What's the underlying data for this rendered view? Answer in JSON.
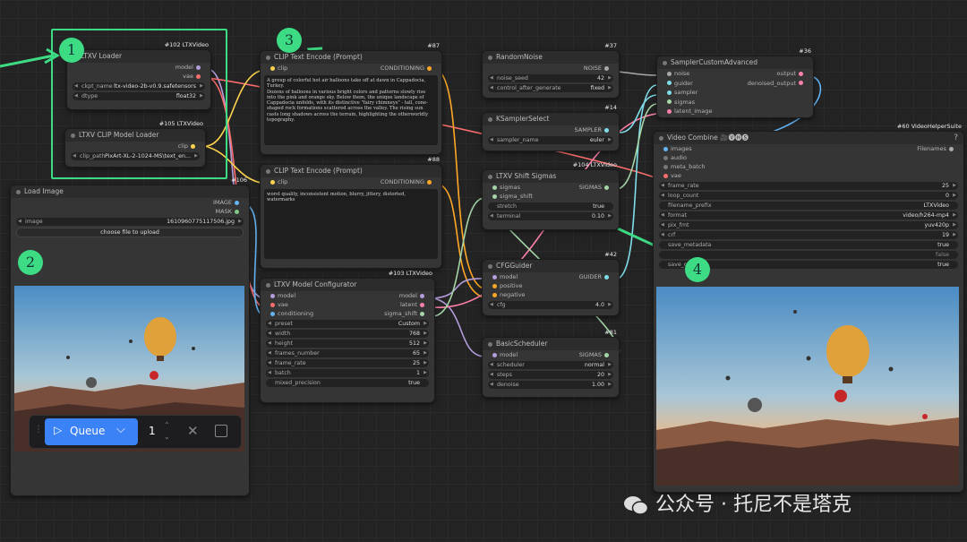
{
  "nodes": {
    "ltxv_loader": {
      "badge": "#102 LTXVideo",
      "title": "LTXV Loader",
      "out1": "model",
      "out2": "vae",
      "w1_label": "ckpt_name",
      "w1_value": "ltx-video-2b-v0.9.safetensors",
      "w2_label": "dtype",
      "w2_value": "float32"
    },
    "clip_loader": {
      "badge": "#105 LTXVideo",
      "title": "LTXV CLIP Model Loader",
      "out1": "clip",
      "w1_label": "clip_path",
      "w1_value": "PixArt-XL-2-1024-MS\\text_en..."
    },
    "clip_text_pos": {
      "badge": "#87",
      "title": "CLIP Text Encode (Prompt)",
      "in1": "clip",
      "out1": "CONDITIONING",
      "text": "A group of colorful hot air balloons take off at dawn in Cappadocia, Turkey.\nDozens of balloons in various bright colors and patterns slowly rise into the pink and orange sky. Below them, the unique landscape of Cappadocia unfolds, with its distinctive \"fairy chimneys\" - tall, cone-shaped rock formations scattered across the valley. The rising sun casts long shadows across the terrain, highlighting the otherworldly topography."
    },
    "clip_text_neg": {
      "badge": "#88",
      "title": "CLIP Text Encode (Prompt)",
      "in1": "clip",
      "out1": "CONDITIONING",
      "text": "worst quality, inconsistent motion, blurry, jittery, distorted, watermarks"
    },
    "load_image": {
      "badge": "#106",
      "title": "Load Image",
      "out1": "IMAGE",
      "out2": "MASK",
      "w1_label": "image",
      "w1_value": "1610960775117506.jpg",
      "upload": "choose file to upload"
    },
    "model_config": {
      "badge": "#103 LTXVideo",
      "title": "LTXV Model Configurator",
      "in1": "model",
      "in2": "vae",
      "in3": "conditioning",
      "out1": "model",
      "out2": "latent",
      "out3": "sigma_shift",
      "widgets": [
        {
          "label": "preset",
          "value": "Custom"
        },
        {
          "label": "width",
          "value": "768"
        },
        {
          "label": "height",
          "value": "512"
        },
        {
          "label": "frames_number",
          "value": "65"
        },
        {
          "label": "frame_rate",
          "value": "25"
        },
        {
          "label": "batch",
          "value": "1"
        },
        {
          "label": "mixed_precision",
          "value": "true"
        }
      ]
    },
    "random_noise": {
      "badge": "#37",
      "title": "RandomNoise",
      "out1": "NOISE",
      "w1_label": "noise_seed",
      "w1_value": "42",
      "w2_label": "control_after_generate",
      "w2_value": "fixed"
    },
    "ksampler_select": {
      "badge": "#14",
      "title": "KSamplerSelect",
      "out1": "SAMPLER",
      "w1_label": "sampler_name",
      "w1_value": "euler"
    },
    "shift_sigmas": {
      "badge": "#104 LTXVideo",
      "title": "LTXV Shift Sigmas",
      "in1": "sigmas",
      "in2": "sigma_shift",
      "out1": "SIGMAS",
      "w1_label": "stretch",
      "w1_value": "true",
      "w2_label": "terminal",
      "w2_value": "0.10"
    },
    "cfg_guider": {
      "badge": "#42",
      "title": "CFGGuider",
      "in1": "model",
      "in2": "positive",
      "in3": "negative",
      "out1": "GUIDER",
      "w1_label": "cfg",
      "w1_value": "4.0"
    },
    "basic_scheduler": {
      "badge": "#81",
      "title": "BasicScheduler",
      "in1": "model",
      "out1": "SIGMAS",
      "w1_label": "scheduler",
      "w1_value": "normal",
      "w2_label": "steps",
      "w2_value": "20",
      "w3_label": "denoise",
      "w3_value": "1.00"
    },
    "sampler_custom": {
      "badge": "#36",
      "title": "SamplerCustomAdvanced",
      "in1": "noise",
      "in2": "guider",
      "in3": "sampler",
      "in4": "sigmas",
      "in5": "latent_image",
      "out1": "output",
      "out2": "denoised_output"
    },
    "video_combine": {
      "badge": "#60 VideoHelperSuite",
      "title": "Video Combine 🎥🅥🅗🅢",
      "help": "?",
      "in1": "images",
      "in2": "audio",
      "in3": "meta_batch",
      "in4": "vae",
      "out1": "Filenames",
      "widgets": [
        {
          "label": "frame_rate",
          "value": "25"
        },
        {
          "label": "loop_count",
          "value": "0"
        },
        {
          "label": "filename_prefix",
          "value": "LTXVideo"
        },
        {
          "label": "format",
          "value": "video/h264-mp4"
        },
        {
          "label": "pix_fmt",
          "value": "yuv420p"
        },
        {
          "label": "crf",
          "value": "19"
        },
        {
          "label": "save_metadata",
          "value": "true"
        },
        {
          "label": "",
          "value": "false"
        },
        {
          "label": "save_output",
          "value": "true"
        }
      ]
    }
  },
  "markers": [
    "1",
    "2",
    "3",
    "4"
  ],
  "queue": {
    "label": "Queue",
    "count": "1"
  },
  "watermark": "公众号 · 托尼不是塔克",
  "colors": {
    "highlight": "#3ddc84",
    "queue_button": "#3b82f6"
  }
}
